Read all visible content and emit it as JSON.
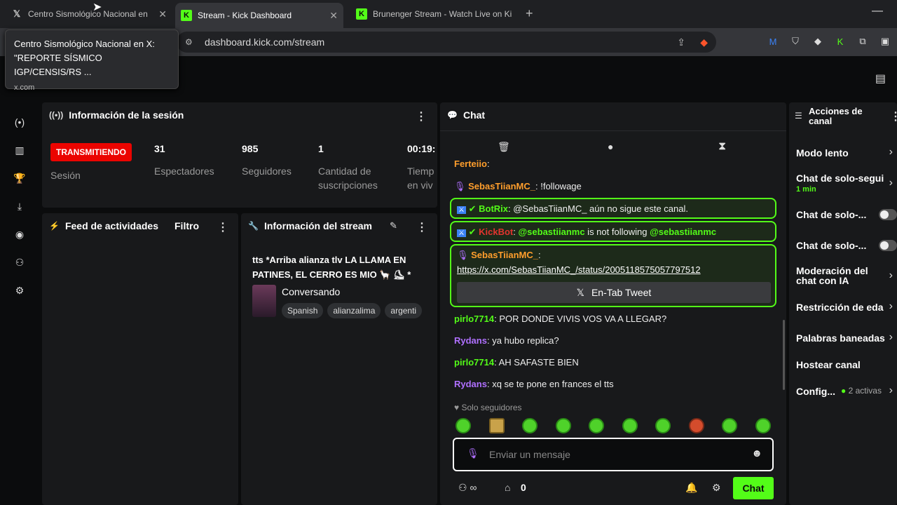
{
  "browser": {
    "tabs": [
      {
        "title": "Centro Sismológico Nacional en",
        "icon": "x-logo"
      },
      {
        "title": "Stream - Kick Dashboard",
        "icon": "kick-logo"
      },
      {
        "title": "Brunenger Stream - Watch Live on Ki",
        "icon": "kick-logo"
      }
    ],
    "url": "dashboard.kick.com/stream",
    "tooltip": {
      "line1": "Centro Sismológico Nacional en X:",
      "line2": "\"REPORTE SÍSMICO IGP/CENSIS/RS ...",
      "domain": "x.com"
    }
  },
  "session": {
    "title": "Información de la sesión",
    "status": "TRANSMITIENDO",
    "status_label": "Sesión",
    "viewers": "31",
    "viewers_label": "Espectadores",
    "followers": "985",
    "followers_label": "Seguidores",
    "subs": "1",
    "subs_label1": "Cantidad de",
    "subs_label2": "suscripciones",
    "time": "00:19:",
    "time_label1": "Tiemp",
    "time_label2": "en viv"
  },
  "feed": {
    "title": "Feed de actividades",
    "filter": "Filtro"
  },
  "stream_info": {
    "title": "Información del stream",
    "stream_title1": "tts *Arriba alianza tlv LA LLAMA EN",
    "stream_title2": "PATINES, EL CERRO ES MIO 🦙 ⛸ *",
    "category": "Conversando",
    "tags": [
      "Spanish",
      "alianzalima",
      "argenti"
    ]
  },
  "chat": {
    "title": "Chat",
    "messages": [
      {
        "user": "Ferteiio",
        "text": ":"
      },
      {
        "user": "SebasTiianMC_",
        "text": ": !followage"
      },
      {
        "user": "BotRix",
        "text": ": @SebasTiianMC_ aún no sigue este canal."
      },
      {
        "user": "KickBot",
        "text": ":",
        "mention1": "@sebastiianmc",
        "mid": " is not following ",
        "mention2": "@sebastiianmc"
      },
      {
        "user": "SebasTiianMC_",
        "text": ":"
      },
      {
        "user": "pirlo7714",
        "text": ": POR DONDE VIVIS VOS VA A LLEGAR?"
      },
      {
        "user": "Rydans",
        "text": ": ya hubo replica?"
      },
      {
        "user": "pirlo7714",
        "text": ": AH SAFASTE BIEN"
      },
      {
        "user": "Rydans",
        "text": ": xq se te pone en frances el tts"
      }
    ],
    "link": "https://x.com/SebasTiianMC_/status/2005118575057797512",
    "embed_label": "En-Tab Tweet",
    "mode": "Solo seguidores",
    "input_placeholder": "Enviar un mensaje",
    "points": "0",
    "send_label": "Chat"
  },
  "channel_actions": {
    "title1": "Acciones de",
    "title2": "canal",
    "items": [
      {
        "label": "Modo lento"
      },
      {
        "label": "Chat de solo-segui",
        "sub": "1 min"
      },
      {
        "label": "Chat de solo-..."
      },
      {
        "label": "Chat de solo-..."
      },
      {
        "label": "Moderación del",
        "label2": "chat con IA"
      },
      {
        "label": "Restricción de eda"
      },
      {
        "label": "Palabras baneadas"
      },
      {
        "label": "Hostear canal"
      },
      {
        "label": "Config...",
        "sub": "2 activas"
      }
    ]
  },
  "colors": {
    "kick_green": "#53fc18",
    "live_red": "#eb0400"
  }
}
